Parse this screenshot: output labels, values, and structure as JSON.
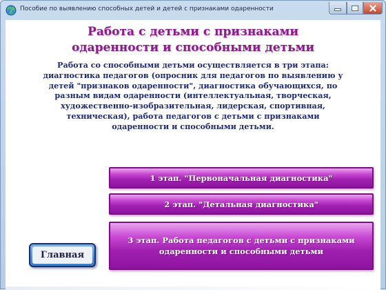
{
  "window": {
    "title": "Пособие по выявлению способных детей и детей с признаками одаренности",
    "icon": "app-globe-icon"
  },
  "heading": {
    "line1": "Работа с детьми с признаками",
    "line2": "одаренности и способными детьми"
  },
  "intro": {
    "lines": [
      "Работа со способными детьми осуществляется в три этапа:",
      "диагностика педагогов (опросник для педагогов по выявлению у",
      "детей \"признаков одаренности\", диагностика обучающихся, по",
      "разным видам одаренности (интеллектуальная, творческая,",
      "художественно-изобразительная, лидерская, спортивная,",
      "техническая), работа педагогов с детьми с признаками",
      "одаренности и способными детьми."
    ]
  },
  "stages": {
    "stage1": "1 этап. \"Первоначальная диагностика\"",
    "stage2": "2 этап. \"Детальная диагностика\"",
    "stage3_line1": "3 этап. Работа педагогов с детьми с признаками",
    "stage3_line2": "одаренности и способными детьми"
  },
  "home_button": {
    "label": "Главная"
  },
  "colors": {
    "heading": "#8a1d8a",
    "intro_text": "#1e2a78",
    "stage_button": "#a020b0",
    "home_button_border": "#1a2e66"
  }
}
